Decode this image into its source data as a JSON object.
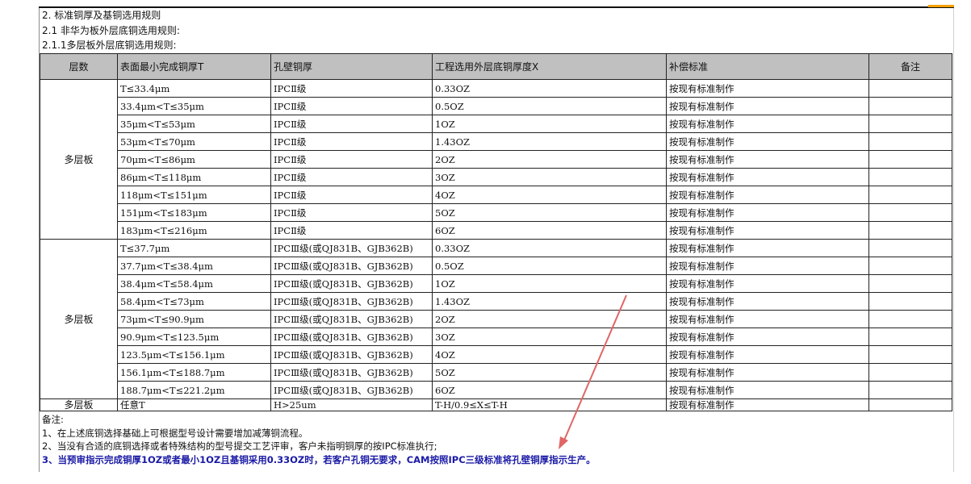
{
  "heading": {
    "line1": "2. 标准铜厚及基铜选用规则",
    "line2": "2.1 非华为板外层底铜选用规则:",
    "line3": "2.1.1多层板外层底铜选用规则:"
  },
  "table": {
    "headers": [
      "层数",
      "表面最小完成铜厚T",
      "孔壁铜厚",
      "工程选用外层底铜厚度X",
      "补偿标准",
      "备注"
    ],
    "groups": [
      {
        "layer": "多层板",
        "rows": [
          {
            "t": "T≤33.4μm",
            "hole": "IPCⅡ级",
            "x": "0.33OZ",
            "comp": "按现有标准制作",
            "note": ""
          },
          {
            "t": "33.4μm<T≤35μm",
            "hole": "IPCⅡ级",
            "x": "0.5OZ",
            "comp": "按现有标准制作",
            "note": ""
          },
          {
            "t": "35μm<T≤53μm",
            "hole": "IPCⅡ级",
            "x": "1OZ",
            "comp": "按现有标准制作",
            "note": ""
          },
          {
            "t": "53μm<T≤70μm",
            "hole": "IPCⅡ级",
            "x": "1.43OZ",
            "comp": "按现有标准制作",
            "note": ""
          },
          {
            "t": "70μm<T≤86μm",
            "hole": "IPCⅡ级",
            "x": "2OZ",
            "comp": "按现有标准制作",
            "note": ""
          },
          {
            "t": "86μm<T≤118μm",
            "hole": "IPCⅡ级",
            "x": "3OZ",
            "comp": "按现有标准制作",
            "note": ""
          },
          {
            "t": "118μm<T≤151μm",
            "hole": "IPCⅡ级",
            "x": "4OZ",
            "comp": "按现有标准制作",
            "note": ""
          },
          {
            "t": "151μm<T≤183μm",
            "hole": "IPCⅡ级",
            "x": "5OZ",
            "comp": "按现有标准制作",
            "note": ""
          },
          {
            "t": "183μm<T≤216μm",
            "hole": "IPCⅡ级",
            "x": "6OZ",
            "comp": "按现有标准制作",
            "note": ""
          }
        ]
      },
      {
        "layer": "多层板",
        "rows": [
          {
            "t": "T≤37.7μm",
            "hole": "IPCⅢ级(或QJ831B、GJB362B)",
            "x": "0.33OZ",
            "comp": "按现有标准制作",
            "note": ""
          },
          {
            "t": "37.7μm<T≤38.4μm",
            "hole": "IPCⅢ级(或QJ831B、GJB362B)",
            "x": "0.5OZ",
            "comp": "按现有标准制作",
            "note": ""
          },
          {
            "t": "38.4μm<T≤58.4μm",
            "hole": "IPCⅢ级(或QJ831B、GJB362B)",
            "x": "1OZ",
            "comp": "按现有标准制作",
            "note": ""
          },
          {
            "t": "58.4μm<T≤73μm",
            "hole": "IPCⅢ级(或QJ831B、GJB362B)",
            "x": "1.43OZ",
            "comp": "按现有标准制作",
            "note": ""
          },
          {
            "t": "73μm<T≤90.9μm",
            "hole": "IPCⅢ级(或QJ831B、GJB362B)",
            "x": "2OZ",
            "comp": "按现有标准制作",
            "note": ""
          },
          {
            "t": "90.9μm<T≤123.5μm",
            "hole": "IPCⅢ级(或QJ831B、GJB362B)",
            "x": "3OZ",
            "comp": "按现有标准制作",
            "note": ""
          },
          {
            "t": "123.5μm<T≤156.1μm",
            "hole": "IPCⅢ级(或QJ831B、GJB362B)",
            "x": "4OZ",
            "comp": "按现有标准制作",
            "note": ""
          },
          {
            "t": "156.1μm<T≤188.7μm",
            "hole": "IPCⅢ级(或QJ831B、GJB362B)",
            "x": "5OZ",
            "comp": "按现有标准制作",
            "note": ""
          },
          {
            "t": "188.7μm<T≤221.2μm",
            "hole": "IPCⅢ级(或QJ831B、GJB362B)",
            "x": "6OZ",
            "comp": "按现有标准制作",
            "note": ""
          }
        ]
      },
      {
        "layer": "多层板",
        "rows": [
          {
            "t": "任意T",
            "hole": "H>25um",
            "x": "T-H/0.9≤X≤T-H",
            "comp": "按现有标准制作",
            "note": ""
          }
        ]
      }
    ]
  },
  "notes": {
    "title": "备注:",
    "items": [
      "1、在上述底铜选择基础上可根据型号设计需要增加减薄铜流程。",
      "2、当没有合适的底铜选择或者特殊结构的型号提交工艺评审，客户未指明铜厚的按IPC标准执行;",
      "3、当预审指示完成铜厚1OZ或者最小1OZ且基铜采用0.33OZ时，若客户孔铜无要求，CAM按照IPC三级标准将孔壁铜厚指示生产。"
    ]
  },
  "colors": {
    "header_bg": "#c0c0c0",
    "highlight_text": "#1a1aa6",
    "annotation_arrow": "#e06666"
  },
  "icons": {
    "annotation": "arrow-annotation-icon"
  }
}
